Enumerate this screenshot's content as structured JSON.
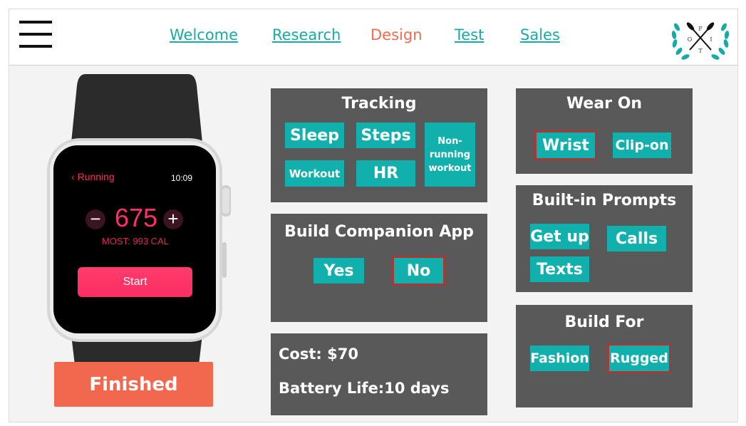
{
  "nav": {
    "links": [
      "Welcome",
      "Research",
      "Design",
      "Test",
      "Sales"
    ],
    "active": "Design"
  },
  "logo": {
    "letters": [
      "F",
      "O",
      "I",
      "T"
    ]
  },
  "watch": {
    "back_label": "Running",
    "time": "10:09",
    "calories": "675",
    "most": "MOST: 993 CAL",
    "start_label": "Start",
    "minus": "−",
    "plus": "+"
  },
  "finished_label": "Finished",
  "tracking": {
    "title": "Tracking",
    "options": [
      "Sleep",
      "Steps",
      "Non-running workout",
      "Workout",
      "HR"
    ]
  },
  "companion": {
    "title": "Build Companion App",
    "options": [
      "Yes",
      "No"
    ],
    "selected": "No"
  },
  "specs": {
    "cost_label": "Cost:",
    "cost_value": "$70",
    "battery_label": "Battery Life:",
    "battery_value": "10 days"
  },
  "wear_on": {
    "title": "Wear On",
    "options": [
      "Wrist",
      "Clip-on"
    ],
    "selected": "Wrist"
  },
  "prompts": {
    "title": "Built-in Prompts",
    "options": [
      "Get up",
      "Calls",
      "Texts"
    ]
  },
  "build_for": {
    "title": "Build For",
    "options": [
      "Fashion",
      "Rugged"
    ],
    "selected": "Rugged"
  },
  "colors": {
    "accent_teal": "#12b0ad",
    "accent_orange": "#f2684f",
    "panel_gray": "#595959",
    "watch_pink": "#ff2f6a"
  }
}
